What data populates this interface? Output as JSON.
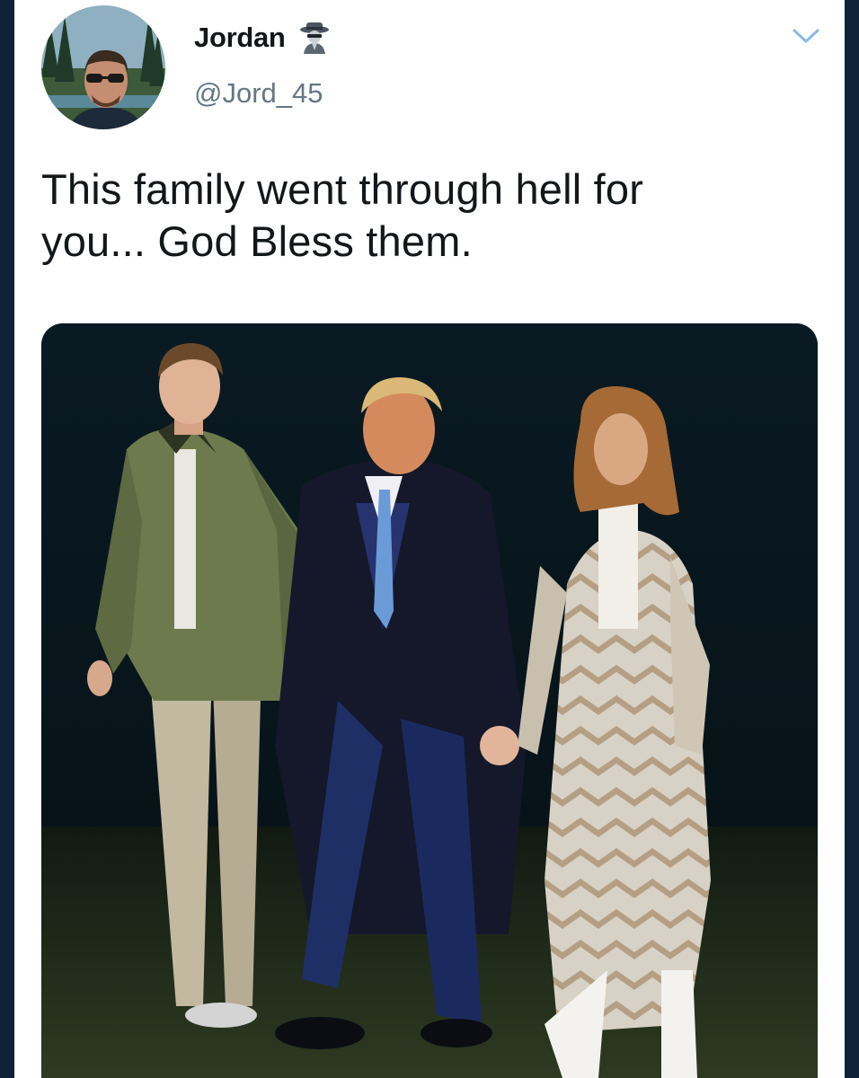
{
  "tweet": {
    "author": {
      "display_name": "Jordan",
      "handle": "@Jord_45",
      "badge_icon": "detective-emoji-icon",
      "avatar_icon": "profile-photo"
    },
    "menu_icon": "chevron-down-icon",
    "text_lines": [
      "This family went through hell for",
      "you... God Bless them."
    ],
    "media": {
      "type": "photo",
      "icon": "family-photo"
    }
  },
  "colors": {
    "page_background": "#0d2236",
    "card_background": "#ffffff",
    "name": "#14171a",
    "handle": "#657786",
    "chevron": "#8bb9e0"
  }
}
